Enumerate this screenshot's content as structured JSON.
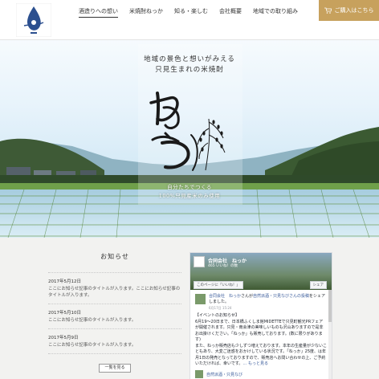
{
  "header": {
    "nav": [
      "酒造りへの想い",
      "米焼酎ねっか",
      "知る・楽しむ",
      "会社概要",
      "地域での取り組み"
    ],
    "buy_label": "ご購入はこちら"
  },
  "hero": {
    "tagline_line1": "地域の景色と想いがみえる",
    "tagline_line2": "只見生まれの米焼酎",
    "bottom_line1": "自分たちでつくる",
    "bottom_line2": "100%只見産米のみ使用"
  },
  "news": {
    "title": "お知らせ",
    "items": [
      {
        "date": "2017年5月12日",
        "text": "ここにお知らせ記事のタイトルが入ります。ここにお知らせ記事のタイトルが入ります。"
      },
      {
        "date": "2017年5月10日",
        "text": "ここにお知らせ記事のタイトルが入ります。"
      },
      {
        "date": "2017年5月9日",
        "text": "ここにお知らせ記事のタイトルが入ります。"
      }
    ],
    "more_label": "一覧を見る"
  },
  "facebook": {
    "page_name": "合同会社　ねっか",
    "likes": "465 いいね！の数",
    "like_button": "このページに「いいね！」",
    "share_button": "シェア",
    "post_author": "合同会社　ねっか",
    "post_action_mid": "さんが",
    "post_action_link": "自然派酒・只見なびさんの投稿",
    "post_action_tail": "をシェアしました。",
    "post_time": "6月17日 15:24",
    "post_body_1": "【イベントのお知らせ】",
    "post_body_2": "6月19〜20日まで、日本橋ふくしま館MIDETTEで只見町観光PRフェアが開催されます。只見・南会津の美味しいものも沢山ありますので是非お出掛けください。「ねっか」も販売しております。(数に限りがあります)",
    "post_body_3": "また、ねっか販売店も少しずつ増えております。本年の生産量が少ないこともあり、大変ご迷惑をおかけしている状況です。「ねっか」25度、は年月1日の発売となっておりますので、販売店へお問い合わせの上、ご予約いただければ、幸いです。",
    "post_more": "… もっと見る",
    "next_post_author": "自然派酒・只見なび"
  },
  "colors": {
    "accent_gold": "#c7a15d",
    "fb_link": "#365899"
  }
}
